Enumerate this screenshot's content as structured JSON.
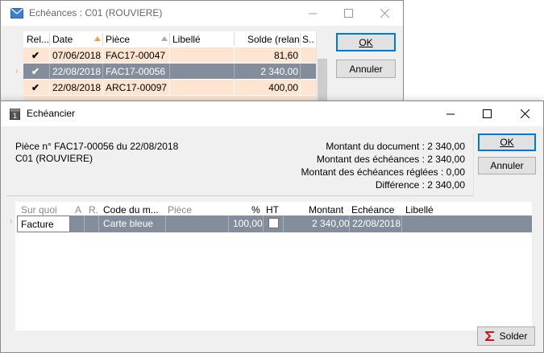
{
  "back_window": {
    "title": "Echéances : C01 (ROUVIERE)",
    "columns": [
      "Rel...",
      "Date",
      "Pièce",
      "Libellé",
      "Solde (relan",
      "S..."
    ],
    "rows": [
      {
        "check": "✔",
        "date": "07/06/2018",
        "piece": "FAC17-00047",
        "libelle": "",
        "solde": "81,60",
        "selected": false
      },
      {
        "check": "✔",
        "date": "22/08/2018",
        "piece": "FAC17-00056",
        "libelle": "",
        "solde": "2 340,00",
        "selected": true
      },
      {
        "check": "✔",
        "date": "22/08/2018",
        "piece": "ARC17-00097",
        "libelle": "",
        "solde": "400,00",
        "selected": false
      }
    ],
    "ok_label": "OK",
    "cancel_label": "Annuler",
    "row_arrow": "›"
  },
  "front_window": {
    "title": "Echéancier",
    "piece_line": "Pièce n° FAC17-00056 du 22/08/2018",
    "client_line": "C01 (ROUVIERE)",
    "montant_document": "Montant du document : 2 340,00",
    "montant_echeances": "Montant des échéances : 2 340,00",
    "montant_reglees": "Montant des échéances réglées : 0,00",
    "difference": "Différence : 2 340,00",
    "ok_label": "OK",
    "cancel_label": "Annuler",
    "solder_label": "Solder",
    "columns": [
      "Sur quoi",
      "A",
      "R.",
      "Code du m...",
      "Pièce",
      "%",
      "HT",
      "Montant",
      "Echéance",
      "Libellé"
    ],
    "row": {
      "sur_quoi": "Facture",
      "a": "",
      "r": "",
      "code": "Carte bleue",
      "piece": "",
      "pct": "100,00",
      "ht_checked": false,
      "montant": "2 340,00",
      "echeance": "22/08/2018",
      "libelle": ""
    },
    "row_arrow": "›"
  },
  "colors": {
    "row_highlight": "#fde5d2",
    "row_selected": "#848d9c",
    "default_button_border": "#0078d7",
    "sort_arrow": "#f0a040"
  }
}
